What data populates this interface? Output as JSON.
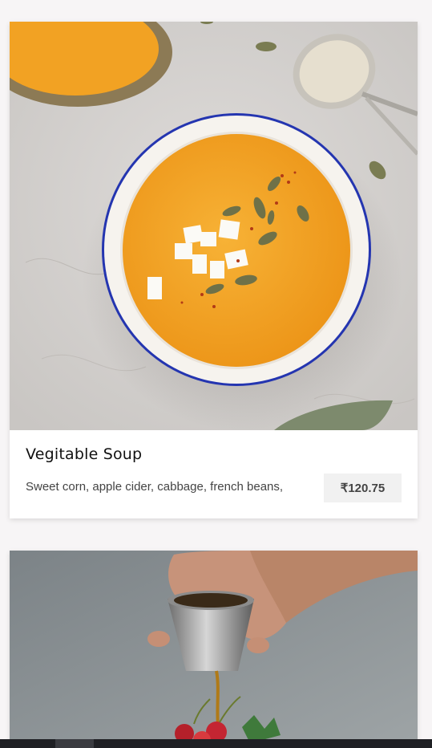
{
  "menu": {
    "items": [
      {
        "title": "Vegitable Soup",
        "description": "Sweet corn, apple cider, cabbage, french beans,",
        "price": "₹120.75",
        "image_icon": "soup-bowl-photo"
      },
      {
        "image_icon": "cocktail-pour-photo"
      }
    ]
  },
  "colors": {
    "page_background": "#f7f5f6",
    "card_background": "#ffffff",
    "price_badge_background": "#f1f1f1",
    "soup_orange": "#f2a223",
    "bowl_rim_blue": "#2435b0",
    "taskbar": "#1f2024"
  }
}
